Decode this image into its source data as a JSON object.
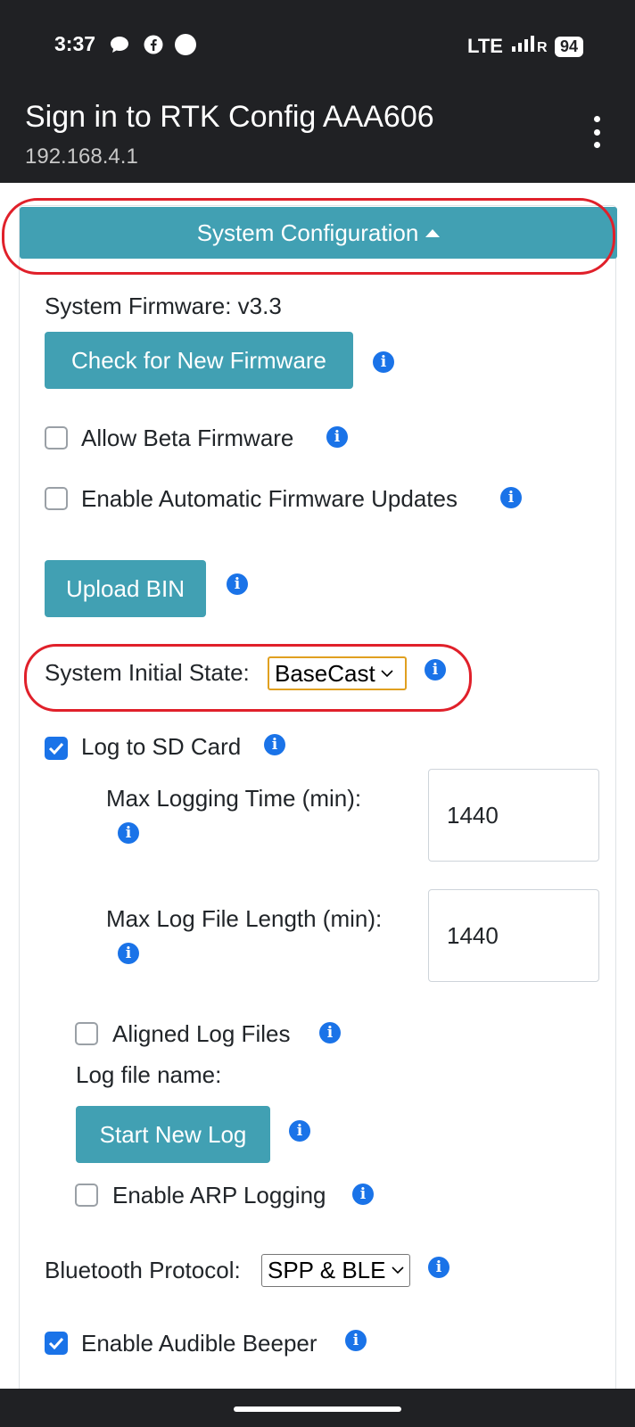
{
  "status_bar": {
    "time": "3:37",
    "icons_left": [
      "chat-bubble-icon",
      "facebook-icon",
      "circle-notification-icon"
    ],
    "network": "LTE",
    "signal": "signal-icon",
    "battery": "94"
  },
  "header": {
    "title": "Sign in to RTK Config AAA606",
    "url": "192.168.4.1",
    "menu_icon": "more-vert-icon"
  },
  "section": {
    "title": "System Configuration"
  },
  "firmware": {
    "version_label": "System Firmware: v3.3",
    "check_button": "Check for New Firmware",
    "allow_beta": {
      "label": "Allow Beta Firmware",
      "checked": false
    },
    "auto_update": {
      "label": "Enable Automatic Firmware Updates",
      "checked": false
    },
    "upload_button": "Upload BIN"
  },
  "initial_state": {
    "label": "System Initial State:",
    "value": "BaseCast"
  },
  "logging": {
    "log_sd": {
      "label": "Log to SD Card",
      "checked": true
    },
    "max_time": {
      "label": "Max Logging Time (min):",
      "value": "1440"
    },
    "max_file": {
      "label": "Max Log File Length (min):",
      "value": "1440"
    },
    "aligned": {
      "label": "Aligned Log Files",
      "checked": false
    },
    "file_name_label": "Log file name:",
    "start_button": "Start New Log",
    "arp": {
      "label": "Enable ARP Logging",
      "checked": false
    }
  },
  "bluetooth": {
    "label": "Bluetooth Protocol:",
    "value": "SPP & BLE"
  },
  "beeper": {
    "label": "Enable Audible Beeper",
    "checked": true
  },
  "colors": {
    "accent": "#41a0b3",
    "info": "#1a73e8",
    "highlight": "#e0202a",
    "focus": "#e0a020"
  }
}
